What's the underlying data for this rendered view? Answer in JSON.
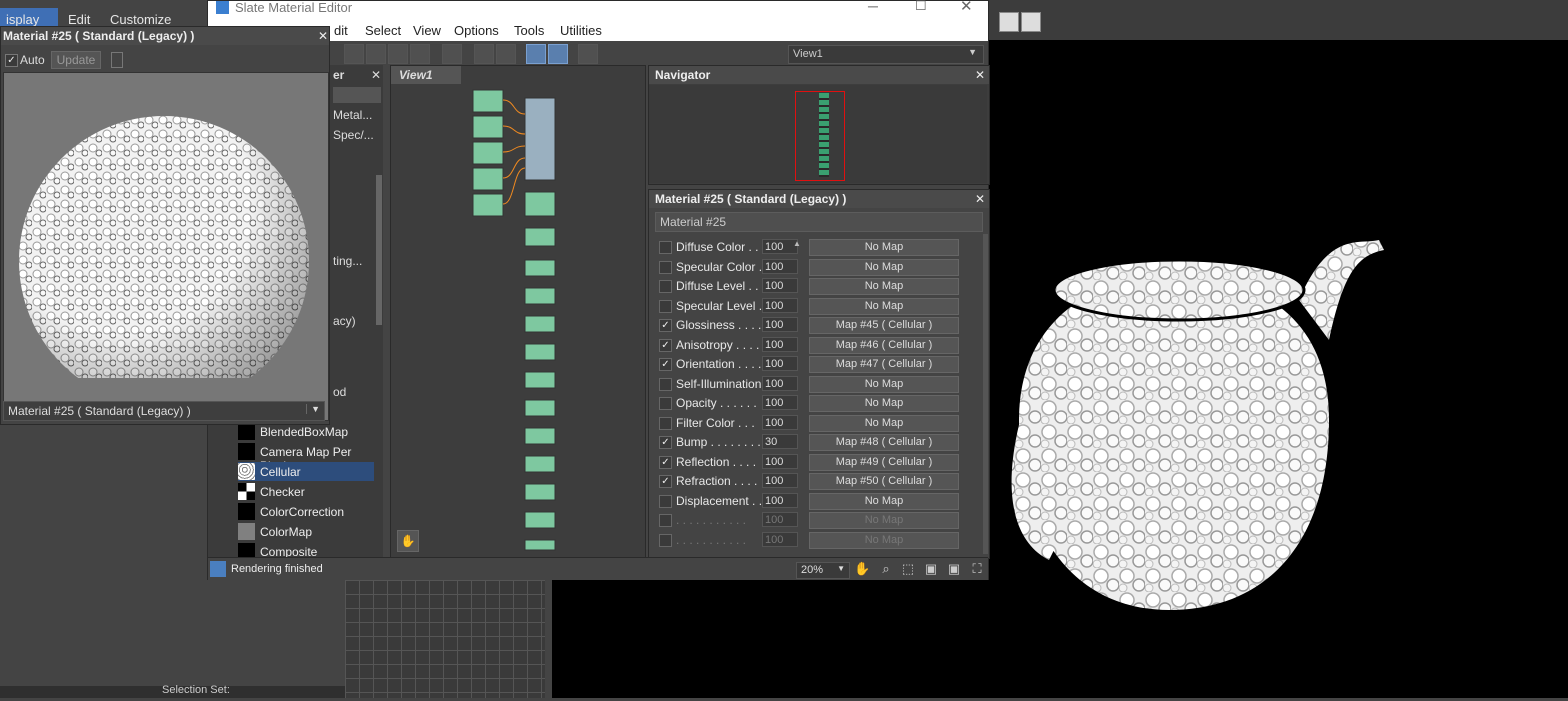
{
  "app_menu": {
    "display": "isplay",
    "edit": "Edit",
    "customize": "Customize"
  },
  "slate": {
    "title": "Slate Material Editor",
    "menu": [
      "dit",
      "Select",
      "View",
      "Options",
      "Tools",
      "Utilities"
    ],
    "view_select": "View1",
    "view_tab": "View1",
    "browser_header": "er",
    "browser_fragments": [
      "Metal...",
      "Spec/...",
      "ting...",
      "acy)",
      "od"
    ],
    "browser_items": [
      {
        "label": "BlendedBoxMap",
        "swatch": "#000000"
      },
      {
        "label": "Camera Map Per Pixel",
        "swatch": "#000000"
      },
      {
        "label": "Cellular",
        "swatch": "#cccccc"
      },
      {
        "label": "Checker",
        "swatch": "#ffffff"
      },
      {
        "label": "ColorCorrection",
        "swatch": "#000000"
      },
      {
        "label": "ColorMap",
        "swatch": "#808080"
      },
      {
        "label": "Composite",
        "swatch": "#000000"
      }
    ],
    "navigator_title": "Navigator",
    "material_panel_title": "Material #25  ( Standard (Legacy) )",
    "material_name": "Material #25",
    "maps": [
      {
        "checked": false,
        "name": "Diffuse Color . . .",
        "amount": "100",
        "map": "No Map"
      },
      {
        "checked": false,
        "name": "Specular Color  .",
        "amount": "100",
        "map": "No Map"
      },
      {
        "checked": false,
        "name": "Diffuse Level . . .",
        "amount": "100",
        "map": "No Map"
      },
      {
        "checked": false,
        "name": "Specular Level  .",
        "amount": "100",
        "map": "No Map"
      },
      {
        "checked": true,
        "name": "Glossiness  . . . .",
        "amount": "100",
        "map": "Map #45  ( Cellular )"
      },
      {
        "checked": true,
        "name": "Anisotropy  . . . .",
        "amount": "100",
        "map": "Map #46  ( Cellular )"
      },
      {
        "checked": true,
        "name": "Orientation . . . .",
        "amount": "100",
        "map": "Map #47  ( Cellular )"
      },
      {
        "checked": false,
        "name": "Self-Illumination .",
        "amount": "100",
        "map": "No Map"
      },
      {
        "checked": false,
        "name": "Opacity . . . . . .",
        "amount": "100",
        "map": "No Map"
      },
      {
        "checked": false,
        "name": "Filter Color  . . .",
        "amount": "100",
        "map": "No Map"
      },
      {
        "checked": true,
        "name": "Bump  . . . . . . . .",
        "amount": "30",
        "map": "Map #48  ( Cellular )"
      },
      {
        "checked": true,
        "name": "Reflection  . . . .",
        "amount": "100",
        "map": "Map #49  ( Cellular )"
      },
      {
        "checked": true,
        "name": "Refraction  . . . .",
        "amount": "100",
        "map": "Map #50  ( Cellular )"
      },
      {
        "checked": false,
        "name": "Displacement  . . .",
        "amount": "100",
        "map": "No Map"
      },
      {
        "checked": false,
        "name": ". . . . . . . . . . .",
        "amount": "100",
        "map": "No Map",
        "dim": true
      },
      {
        "checked": false,
        "name": ". . . . . . . . . . .",
        "amount": "100",
        "map": "No Map",
        "dim": true
      }
    ],
    "status_text": "Rendering finished",
    "zoom": "20%"
  },
  "preview": {
    "title": "Material #25  ( Standard (Legacy) )",
    "auto_label": "Auto",
    "update_label": "Update",
    "footer": "Material #25  ( Standard (Legacy) )"
  },
  "bottom": {
    "selection": "Selection Set:"
  }
}
